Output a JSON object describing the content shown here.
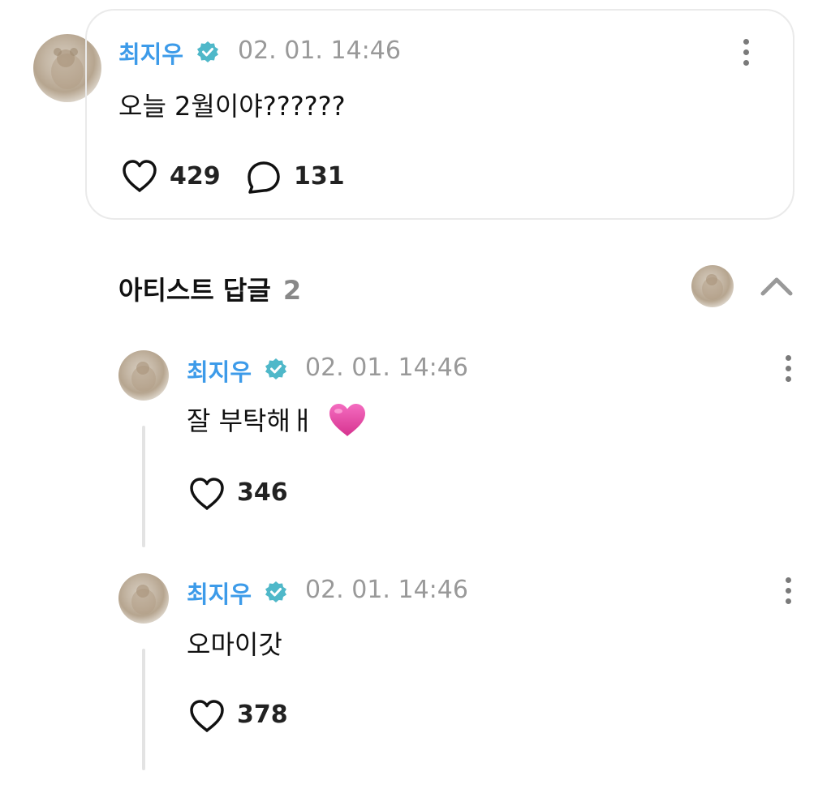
{
  "post": {
    "author": "최지우",
    "timestamp": "02. 01. 14:46",
    "message": "오늘 2월이야??????",
    "likes": "429",
    "comments": "131"
  },
  "replies_section": {
    "title": "아티스트 답글",
    "count": "2"
  },
  "replies": [
    {
      "author": "최지우",
      "timestamp": "02. 01. 14:46",
      "message": "잘 부탁해ㅐ",
      "emoji": "💗",
      "likes": "346"
    },
    {
      "author": "최지우",
      "timestamp": "02. 01. 14:46",
      "message": "오마이갓",
      "likes": "378"
    }
  ],
  "colors": {
    "author_name": "#3d9be9",
    "verified_badge": "#4fb8c9",
    "timestamp": "#999999",
    "heart_emoji": "#e84aa5"
  },
  "icons": [
    "verified-badge-icon",
    "more-vertical-icon",
    "heart-icon",
    "comment-bubble-icon",
    "chevron-up-icon"
  ]
}
